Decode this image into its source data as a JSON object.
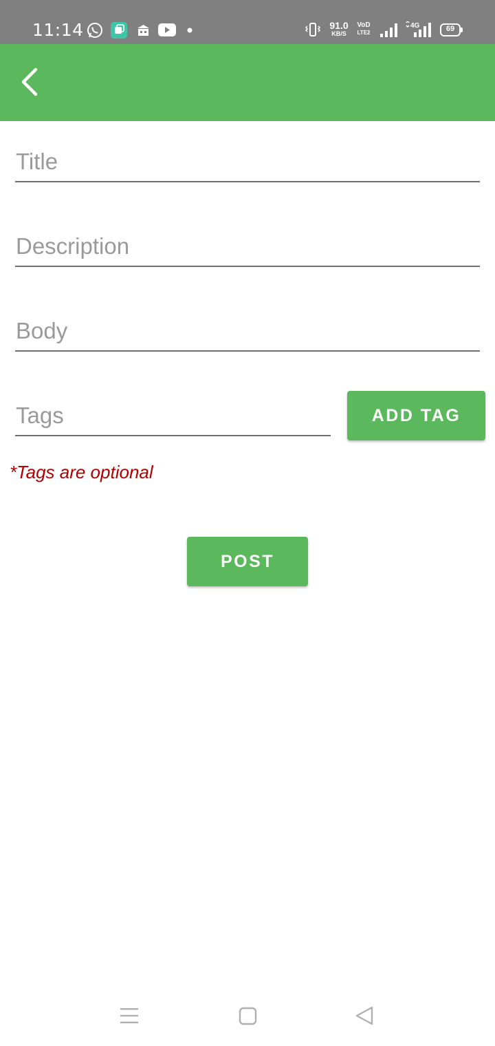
{
  "status_bar": {
    "time": "11:14",
    "notification_icons": [
      "whatsapp-icon",
      "app-icon",
      "bank-icon",
      "youtube-icon",
      "dot-icon"
    ],
    "net_speed_value": "91.0",
    "net_speed_unit": "KB/S",
    "volte_top": "VoD",
    "volte_bottom": "LTE2",
    "network_type": "4G",
    "battery": "69"
  },
  "app_bar": {
    "color": "#5cb85c",
    "back_icon": "chevron-left-icon"
  },
  "form": {
    "title_placeholder": "Title",
    "description_placeholder": "Description",
    "body_placeholder": "Body",
    "tags_placeholder": "Tags",
    "add_tag_label": "ADD TAG",
    "tags_note": "*Tags are optional",
    "post_label": "POST"
  },
  "colors": {
    "accent": "#5cb85c",
    "note": "#b00000",
    "status_bar": "#808080"
  },
  "nav_bar": {
    "items": [
      "menu-icon",
      "home-icon",
      "back-icon"
    ]
  }
}
